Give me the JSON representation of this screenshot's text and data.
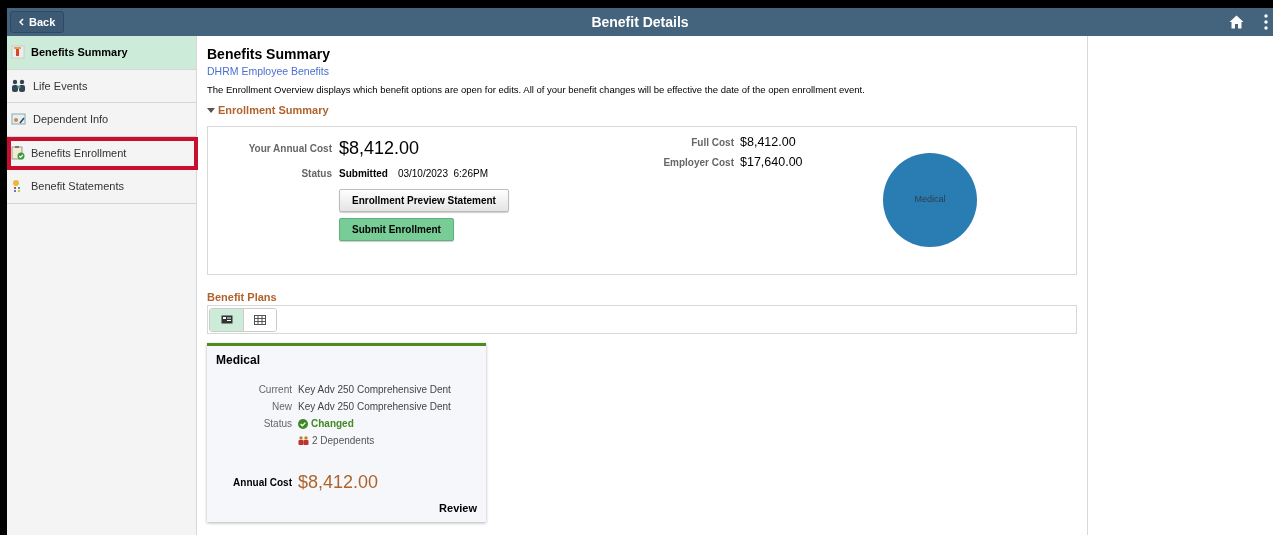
{
  "header": {
    "back_label": "Back",
    "title": "Benefit Details"
  },
  "sidebar": {
    "items": [
      {
        "label": "Benefits Summary",
        "kind": "summary",
        "selected": true,
        "highlighted": false
      },
      {
        "label": "Life Events",
        "kind": "people",
        "selected": false,
        "highlighted": false
      },
      {
        "label": "Dependent Info",
        "kind": "dependent",
        "selected": false,
        "highlighted": false
      },
      {
        "label": "Benefits Enrollment",
        "kind": "enrollment",
        "selected": false,
        "highlighted": true
      },
      {
        "label": "Benefit Statements",
        "kind": "statements",
        "selected": false,
        "highlighted": false
      }
    ]
  },
  "page": {
    "title": "Benefits Summary",
    "link": "DHRM Employee Benefits",
    "description": "The Enrollment Overview displays which benefit options are open for edits. All of your benefit changes will be effective the date of the open enrollment event.",
    "section_title": "Enrollment Summary",
    "expanded": true
  },
  "summary": {
    "annual_cost_label": "Your Annual Cost",
    "annual_cost": "$8,412.00",
    "status_label": "Status",
    "status": "Submitted",
    "status_date": "03/10/2023  6:26PM",
    "buttons": [
      {
        "label": "Enrollment Preview Statement",
        "kind": "secondary"
      },
      {
        "label": "Submit Enrollment",
        "kind": "primary"
      }
    ],
    "full_cost_label": "Full Cost",
    "full_cost": "$8,412.00",
    "employer_cost_label": "Employer Cost",
    "employer_cost": "$17,640.00",
    "pie_label": "Medical"
  },
  "benefit_plans": {
    "title": "Benefit Plans",
    "views": [
      {
        "kind": "cards",
        "selected": true
      },
      {
        "kind": "grid",
        "selected": false
      }
    ],
    "cards": [
      {
        "title": "Medical",
        "current_label": "Current",
        "current": "Key Adv 250 Comprehensive Dent",
        "new_label": "New",
        "new": "Key Adv 250 Comprehensive Dent",
        "status_label": "Status",
        "status": "Changed",
        "dependents": "2 Dependents",
        "annual_cost_label": "Annual Cost",
        "annual_cost": "$8,412.00",
        "action": "Review"
      }
    ]
  }
}
